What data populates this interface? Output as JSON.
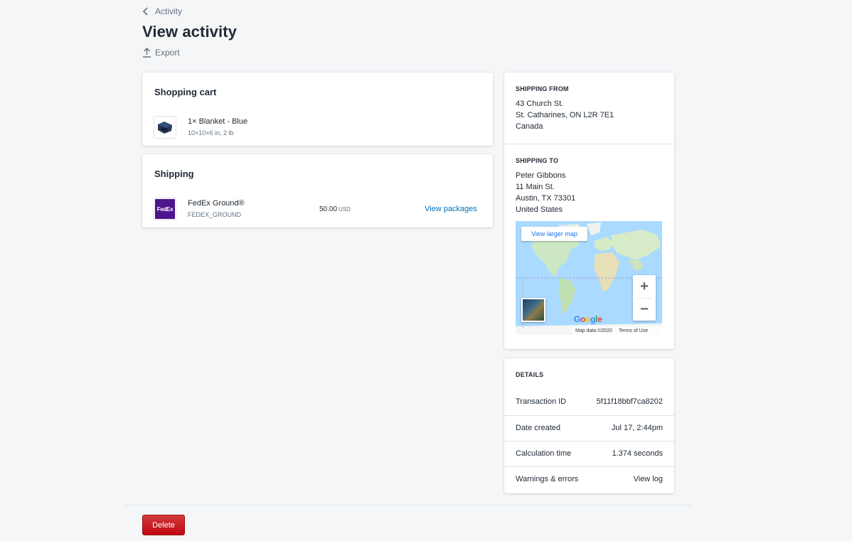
{
  "header": {
    "breadcrumb": "Activity",
    "title": "View activity",
    "export_label": "Export"
  },
  "cart": {
    "title": "Shopping cart",
    "item_name": "1× Blanket - Blue",
    "item_dims": "10×10×6 in, 2 lb"
  },
  "shipping": {
    "title": "Shipping",
    "carrier_logo": "FedEx",
    "service_name": "FedEx Ground®",
    "service_code": "FEDEX_GROUND",
    "price": "50.00",
    "currency": "USD",
    "view_packages": "View packages"
  },
  "ship_from": {
    "label": "SHIPPING FROM",
    "lines": [
      "43 Church St.",
      "St. Catharines, ON L2R 7E1",
      "Canada"
    ]
  },
  "ship_to": {
    "label": "SHIPPING TO",
    "lines": [
      "Peter Gibbons",
      "11 Main St.",
      "Austin, TX 73301",
      "United States"
    ]
  },
  "map": {
    "view_larger": "View larger map",
    "zoom_in": "+",
    "zoom_out": "−",
    "google": "Google",
    "map_data": "Map data ©2020",
    "terms": "Terms of Use"
  },
  "details": {
    "label": "DETAILS",
    "rows": [
      {
        "key": "Transaction ID",
        "value": "5f11f18bbf7ca8202"
      },
      {
        "key": "Date created",
        "value": "Jul 17, 2:44pm"
      },
      {
        "key": "Calculation time",
        "value": "1.374 seconds"
      },
      {
        "key": "Warnings & errors",
        "value": "View log"
      }
    ]
  },
  "footer": {
    "delete_label": "Delete"
  },
  "colors": {
    "accent_link": "#006fbb",
    "danger": "#bf0711",
    "fedex_purple": "#4d148c"
  }
}
